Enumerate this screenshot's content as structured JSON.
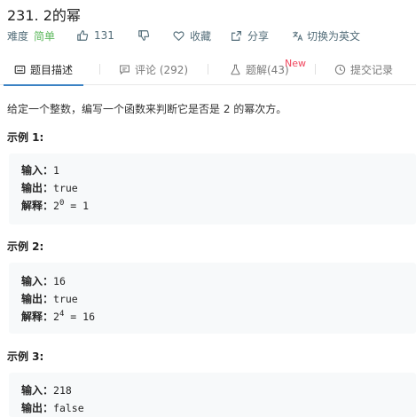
{
  "problem": {
    "title": "231. 2的幂"
  },
  "meta": {
    "difficulty_label": "难度",
    "difficulty_value": "简单",
    "difficulty_color": "#5cb85c",
    "likes": "131",
    "collect_label": "收藏",
    "share_label": "分享",
    "translate_label": "切换为英文"
  },
  "tabs": {
    "description": "题目描述",
    "comments": "评论 (292)",
    "solutions": "题解(43)",
    "solutions_badge": "New",
    "submissions": "提交记录",
    "active_color": "#3b82c4"
  },
  "content": {
    "description": "给定一个整数，编写一个函数来判断它是否是 2 的幂次方。",
    "examples": [
      {
        "title": "示例 1:",
        "input_label": "输入：",
        "input": "1",
        "output_label": "输出：",
        "output": "true",
        "explain_label": "解释：",
        "explain_base": "2",
        "explain_exp": "0",
        "explain_rest": " = 1"
      },
      {
        "title": "示例 2:",
        "input_label": "输入：",
        "input": "16",
        "output_label": "输出：",
        "output": "true",
        "explain_label": "解释：",
        "explain_base": "2",
        "explain_exp": "4",
        "explain_rest": " = 16"
      },
      {
        "title": "示例 3:",
        "input_label": "输入：",
        "input": "218",
        "output_label": "输出：",
        "output": "false"
      }
    ]
  }
}
